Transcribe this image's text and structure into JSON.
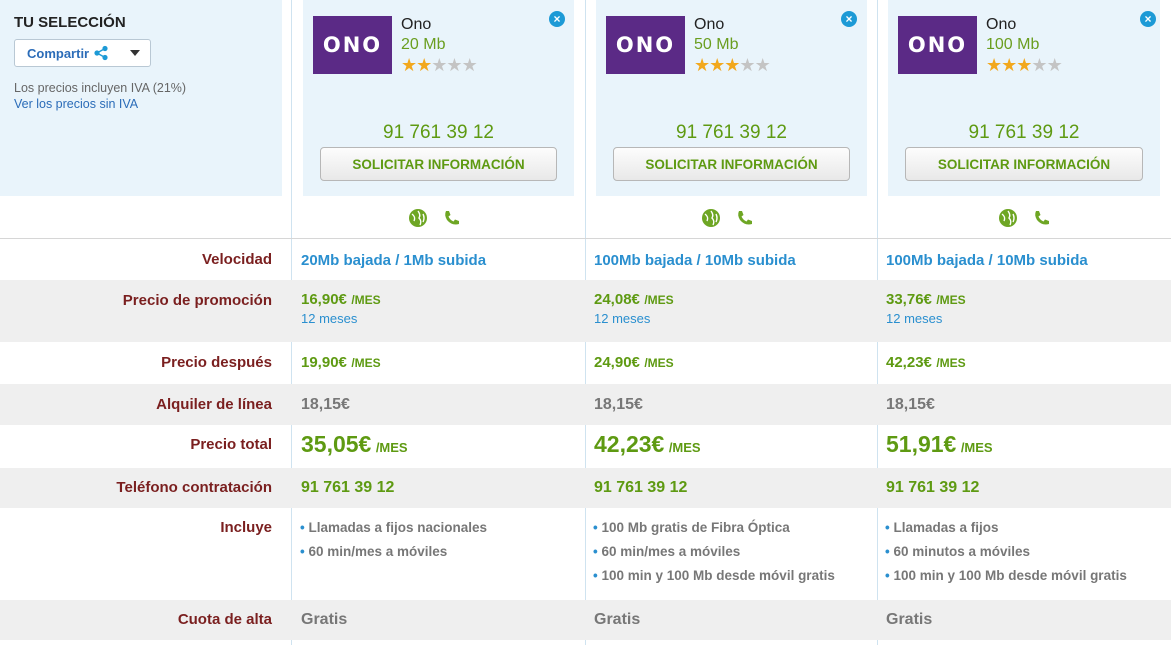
{
  "sidebar": {
    "title": "TU SELECCIÓN",
    "share_label": "Compartir",
    "iva_text": "Los precios incluyen IVA (21%)",
    "iva_link": "Ver los precios sin IVA"
  },
  "offers": [
    {
      "brand": "Ono",
      "logo_text": "ONO",
      "speed_title": "20 Mb",
      "stars": 2,
      "phone": "91 761 39 12",
      "button_label": "SOLICITAR INFORMACIÓN",
      "velocidad": "20Mb bajada / 1Mb subida",
      "promo_price": "16,90€",
      "promo_unit": "/MES",
      "promo_months": "12 meses",
      "after_price": "19,90€",
      "after_unit": "/MES",
      "line_rental": "18,15€",
      "total_price": "35,05€",
      "total_unit": "/MES",
      "contact_phone": "91 761 39 12",
      "includes": [
        "Llamadas a fijos nacionales",
        "60 min/mes a móviles"
      ],
      "signup_fee": "Gratis"
    },
    {
      "brand": "Ono",
      "logo_text": "ONO",
      "speed_title": "50 Mb",
      "stars": 3,
      "phone": "91 761 39 12",
      "button_label": "SOLICITAR INFORMACIÓN",
      "velocidad": "100Mb bajada / 10Mb subida",
      "promo_price": "24,08€",
      "promo_unit": "/MES",
      "promo_months": "12 meses",
      "after_price": "24,90€",
      "after_unit": "/MES",
      "line_rental": "18,15€",
      "total_price": "42,23€",
      "total_unit": "/MES",
      "contact_phone": "91 761 39 12",
      "includes": [
        "100 Mb gratis de Fibra Óptica",
        "60 min/mes a móviles",
        "100 min y 100 Mb desde móvil gratis"
      ],
      "signup_fee": "Gratis"
    },
    {
      "brand": "Ono",
      "logo_text": "ONO",
      "speed_title": "100 Mb",
      "stars": 3,
      "phone": "91 761 39 12",
      "button_label": "SOLICITAR INFORMACIÓN",
      "velocidad": "100Mb bajada / 10Mb subida",
      "promo_price": "33,76€",
      "promo_unit": "/MES",
      "promo_months": "12 meses",
      "after_price": "42,23€",
      "after_unit": "/MES",
      "line_rental": "18,15€",
      "total_price": "51,91€",
      "total_unit": "/MES",
      "contact_phone": "91 761 39 12",
      "includes": [
        "Llamadas a fijos",
        "60 minutos a móviles",
        "100 min y 100 Mb desde móvil gratis"
      ],
      "signup_fee": "Gratis"
    }
  ],
  "rows": {
    "velocidad": "Velocidad",
    "promo": "Precio de promoción",
    "after": "Precio después",
    "line": "Alquiler de línea",
    "total": "Precio total",
    "contact": "Teléfono contratación",
    "includes": "Incluye",
    "signup": "Cuota de alta"
  },
  "colors": {
    "accent_green": "#5e9a12",
    "link_blue": "#2a8fcf",
    "label_red": "#7a1f1f",
    "brand_purple": "#5b2a86"
  }
}
